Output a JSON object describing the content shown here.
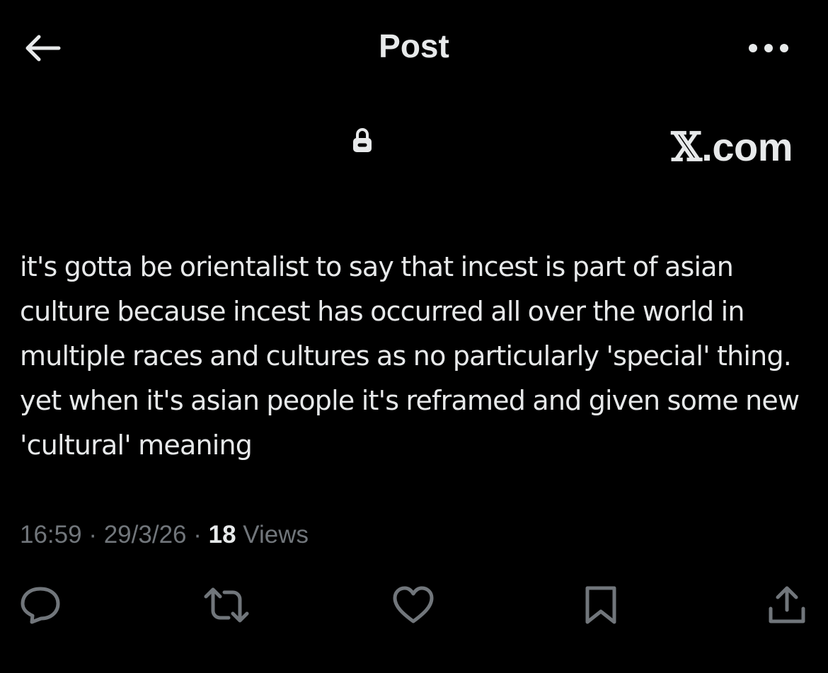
{
  "header": {
    "title": "Post",
    "back_icon": "arrow-left-icon",
    "more_icon": "more-horizontal-icon"
  },
  "banner": {
    "lock_icon": "lock-icon",
    "x_glyph": "𝕏",
    "domain_suffix": ".com"
  },
  "post": {
    "text": "it's gotta be orientalist to say that incest is part of asian culture because incest has occurred all over the world in multiple races and cultures as no particularly 'special' thing. yet when it's asian people it's reframed and given some new 'cultural' meaning",
    "time": "16:59",
    "separator": "·",
    "date": "29/3/26",
    "views_count": "18",
    "views_label": "Views"
  },
  "actions": {
    "reply_icon": "reply-icon",
    "repost_icon": "repost-icon",
    "like_icon": "heart-icon",
    "bookmark_icon": "bookmark-icon",
    "share_icon": "share-icon"
  },
  "colors": {
    "background": "#000000",
    "primary_text": "#e7e9ea",
    "secondary_text": "#71767b"
  }
}
